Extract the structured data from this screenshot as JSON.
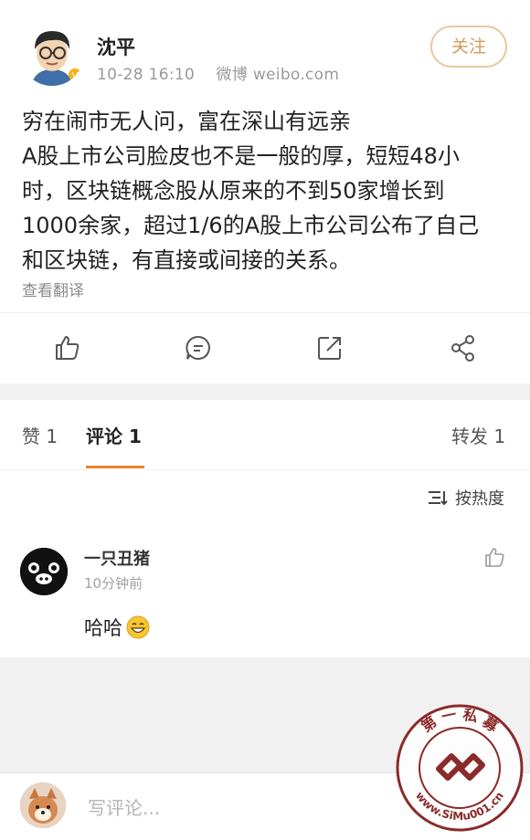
{
  "post": {
    "author": "沈平",
    "time": "10-28 16:10",
    "source": "微博 weibo.com",
    "follow_label": "关注",
    "text_lines": [
      "穷在闹市无人问，富在深山有远亲",
      "A股上市公司脸皮也不是一般的厚，短短48小",
      "时，区块链概念股从原来的不到50家增长到",
      "1000余家，超过1/6的A股上市公司公布了自己",
      "和区块链，有直接或间接的关系。"
    ],
    "translate_label": "查看翻译"
  },
  "actions": [
    "like-icon",
    "comment-icon",
    "repost-icon",
    "share-icon"
  ],
  "tabs": {
    "likes": "赞 1",
    "comments": "评论 1",
    "reposts": "转发 1"
  },
  "sort_label": "按热度",
  "comment": {
    "user": "一只丑猪",
    "time": "10分钟前",
    "text": "哈哈"
  },
  "bottom": {
    "placeholder": "写评论..."
  },
  "watermark": {
    "text_top": "第 一 私 募",
    "text_bottom": "www.SiMu001.cn",
    "color": "#8b2a2a"
  },
  "colors": {
    "accent": "#e8822d",
    "follow": "#d89a57"
  }
}
